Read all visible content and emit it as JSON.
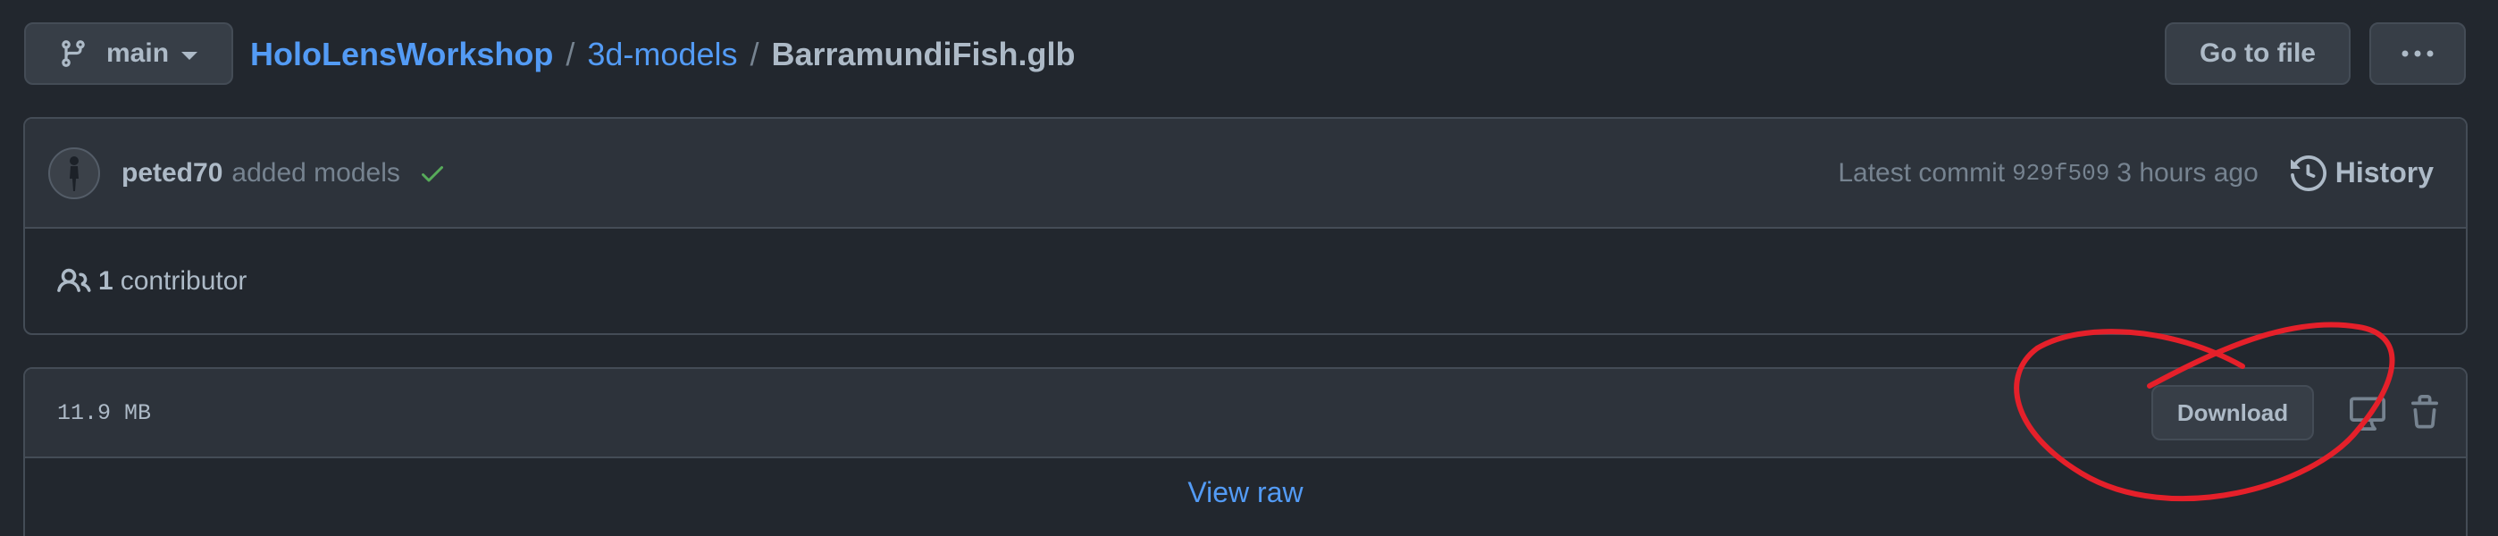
{
  "branch": {
    "name": "main",
    "icon": "git-branch-icon"
  },
  "breadcrumb": {
    "repo": "HoloLensWorkshop",
    "folder": "3d-models",
    "separator": "/",
    "file": "BarramundiFish.glb"
  },
  "toolbar": {
    "goto_label": "Go to file",
    "more_icon": "kebab-horizontal-icon"
  },
  "commit": {
    "author": "peted70",
    "message": "added models",
    "status_icon": "check-icon",
    "status_color": "#57ab5a",
    "latest_label": "Latest commit",
    "sha": "929f509",
    "time_ago": "3 hours ago",
    "history_label": "History"
  },
  "contributors": {
    "count": "1",
    "label": "contributor"
  },
  "file": {
    "size": "11.9 MB",
    "download_label": "Download",
    "view_raw_label": "View raw"
  },
  "colors": {
    "background": "#22272e",
    "surface": "#2d333b",
    "border": "#444c56",
    "link": "#539bf5",
    "annotation": "#e5202a"
  }
}
